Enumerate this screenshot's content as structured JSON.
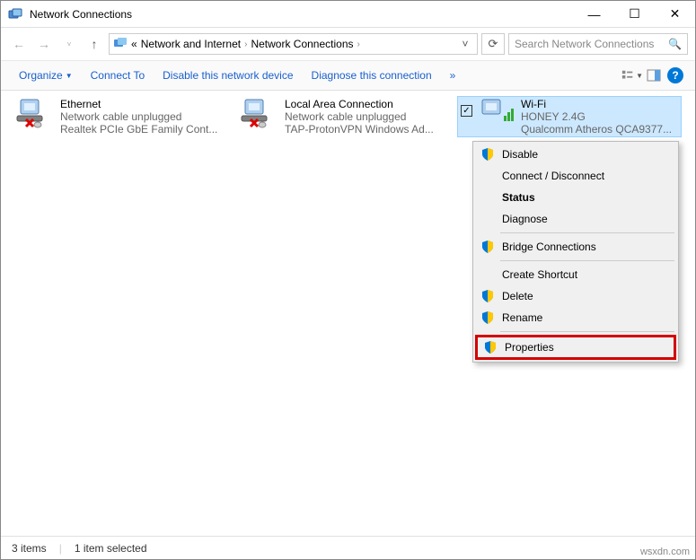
{
  "window": {
    "title": "Network Connections",
    "minimize": "—",
    "maximize": "☐",
    "close": "✕"
  },
  "address": {
    "prefix": "«",
    "crumb1": "Network and Internet",
    "crumb2": "Network Connections"
  },
  "search": {
    "placeholder": "Search Network Connections"
  },
  "toolbar": {
    "organize": "Organize",
    "connect_to": "Connect To",
    "disable": "Disable this network device",
    "diagnose": "Diagnose this connection",
    "more": "»"
  },
  "connections": [
    {
      "name": "Ethernet",
      "status": "Network cable unplugged",
      "device": "Realtek PCIe GbE Family Cont..."
    },
    {
      "name": "Local Area Connection",
      "status": "Network cable unplugged",
      "device": "TAP-ProtonVPN Windows Ad..."
    },
    {
      "name": "Wi-Fi",
      "status": "HONEY 2.4G",
      "device": "Qualcomm Atheros QCA9377..."
    }
  ],
  "context_menu": {
    "disable": "Disable",
    "connect": "Connect / Disconnect",
    "status": "Status",
    "diagnose": "Diagnose",
    "bridge": "Bridge Connections",
    "shortcut": "Create Shortcut",
    "delete": "Delete",
    "rename": "Rename",
    "properties": "Properties"
  },
  "status_bar": {
    "items": "3 items",
    "selected": "1 item selected"
  },
  "watermark": "wsxdn.com"
}
